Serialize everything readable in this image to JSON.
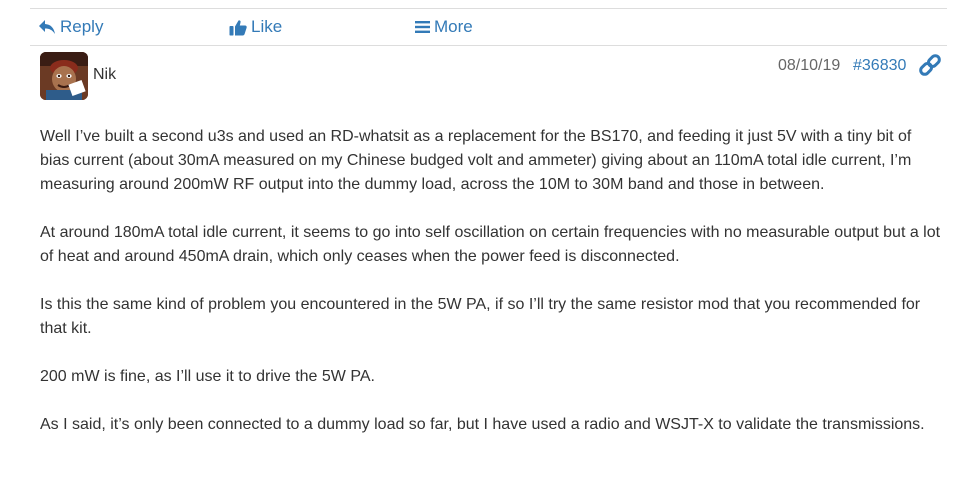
{
  "actions": {
    "reply_label": "Reply",
    "like_label": "Like",
    "more_label": "More"
  },
  "post": {
    "author": "Nik",
    "date": "08/10/19",
    "id": "#36830",
    "paragraphs": [
      "Well I’ve built a second u3s and used an RD-whatsit as a replacement for the BS170, and feeding it just 5V with a tiny bit of bias current (about 30mA measured on my Chinese budged volt and ammeter) giving about an 110mA total idle current, I’m measuring around 200mW RF output into the dummy load, across the 10M to 30M band and those in between.",
      "At around 180mA total idle current, it seems to go into self oscillation on certain frequencies with no measurable output but a lot of heat and around 450mA drain, which only ceases when the power feed is disconnected.",
      "Is this the same kind of problem you encountered in the 5W PA, if so I’ll try the same resistor mod that you recommended for that kit.",
      "200 mW is fine, as I’ll use it to drive the 5W PA.",
      "As I said, it’s only been connected to a dummy load so far, but I have used a radio and WSJT-X to validate the transmissions."
    ]
  },
  "icons": {
    "reply": "reply-arrow-icon",
    "like": "thumbs-up-icon",
    "more": "hamburger-icon",
    "permalink": "link-icon"
  },
  "colors": {
    "link": "#337ab7",
    "text": "#333333",
    "muted": "#666666",
    "divider": "#dddddd"
  }
}
